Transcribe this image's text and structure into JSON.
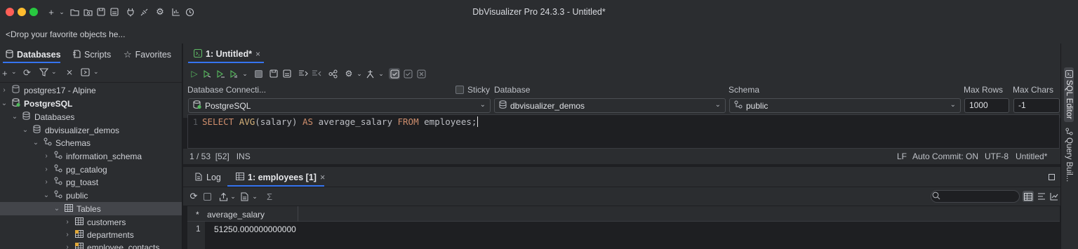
{
  "window": {
    "title": "DbVisualizer Pro 24.3.3 - Untitled*",
    "traffic_colors": [
      "#ff5f57",
      "#febc2e",
      "#28c840"
    ]
  },
  "favorites_bar": {
    "text": "<Drop your favorite objects he..."
  },
  "left_tabs": [
    {
      "label": "Databases",
      "icon": "database-icon"
    },
    {
      "label": "Scripts",
      "icon": "scripts-icon"
    },
    {
      "label": "Favorites",
      "icon": "star-icon"
    }
  ],
  "tree": [
    {
      "label": "postgres17 - Alpine",
      "icon": "connection-icon",
      "chevron": "collapsed"
    },
    {
      "label": "PostgreSQL",
      "icon": "connection-active-icon",
      "chevron": "expanded"
    },
    {
      "label": "Databases",
      "icon": "databases-icon",
      "chevron": "expanded"
    },
    {
      "label": "dbvisualizer_demos",
      "icon": "database-icon",
      "chevron": "expanded"
    },
    {
      "label": "Schemas",
      "icon": "schema-icon",
      "chevron": "expanded"
    },
    {
      "label": "information_schema",
      "icon": "schema-icon",
      "chevron": "collapsed"
    },
    {
      "label": "pg_catalog",
      "icon": "schema-icon",
      "chevron": "collapsed"
    },
    {
      "label": "pg_toast",
      "icon": "schema-icon",
      "chevron": "collapsed"
    },
    {
      "label": "public",
      "icon": "schema-icon",
      "chevron": "expanded"
    },
    {
      "label": "Tables",
      "icon": "table-icon",
      "chevron": "expanded"
    },
    {
      "label": "customers",
      "icon": "table-icon",
      "chevron": "collapsed"
    },
    {
      "label": "departments",
      "icon": "table-pk-icon",
      "chevron": "collapsed"
    },
    {
      "label": "employee_contacts",
      "icon": "table-pk-icon",
      "chevron": "collapsed"
    }
  ],
  "editor_tab": {
    "label": "1: Untitled*"
  },
  "connection": {
    "connection_label": "Database Connecti...",
    "sticky_label": "Sticky",
    "database_label": "Database",
    "schema_label": "Schema",
    "max_rows_label": "Max Rows",
    "max_chars_label": "Max Chars",
    "connection_value": "PostgreSQL",
    "database_value": "dbvisualizer_demos",
    "schema_value": "public",
    "max_rows_value": "1000",
    "max_chars_value": "-1"
  },
  "editor": {
    "line_number": "1",
    "sql": {
      "kw1": "SELECT",
      "fn": "AVG",
      "arg": "(salary)",
      "kw2": "AS",
      "alias": "average_salary",
      "kw3": "FROM",
      "table": "employees;"
    }
  },
  "status": {
    "position": "1 / 53  [52]   INS",
    "line_ending": "LF",
    "auto_commit": "Auto Commit: ON",
    "encoding": "UTF-8",
    "doc_name": "Untitled*"
  },
  "result_tabs": [
    {
      "label": "Log",
      "icon": "log-icon"
    },
    {
      "label": "1: employees [1]",
      "icon": "grid-icon"
    }
  ],
  "grid": {
    "columns": [
      "average_salary"
    ],
    "row_marker_header": "*",
    "rows": [
      {
        "num": "1",
        "cells": [
          "51250.000000000000"
        ]
      }
    ]
  },
  "right_tabs": [
    {
      "label": "SQL Editor"
    },
    {
      "label": "Query Buil..."
    }
  ],
  "colors": {
    "accent": "#3574f0",
    "keyword": "#cf8e6d",
    "function": "#d6b27b",
    "background": "#1e1f22",
    "panel": "#2b2d30"
  }
}
